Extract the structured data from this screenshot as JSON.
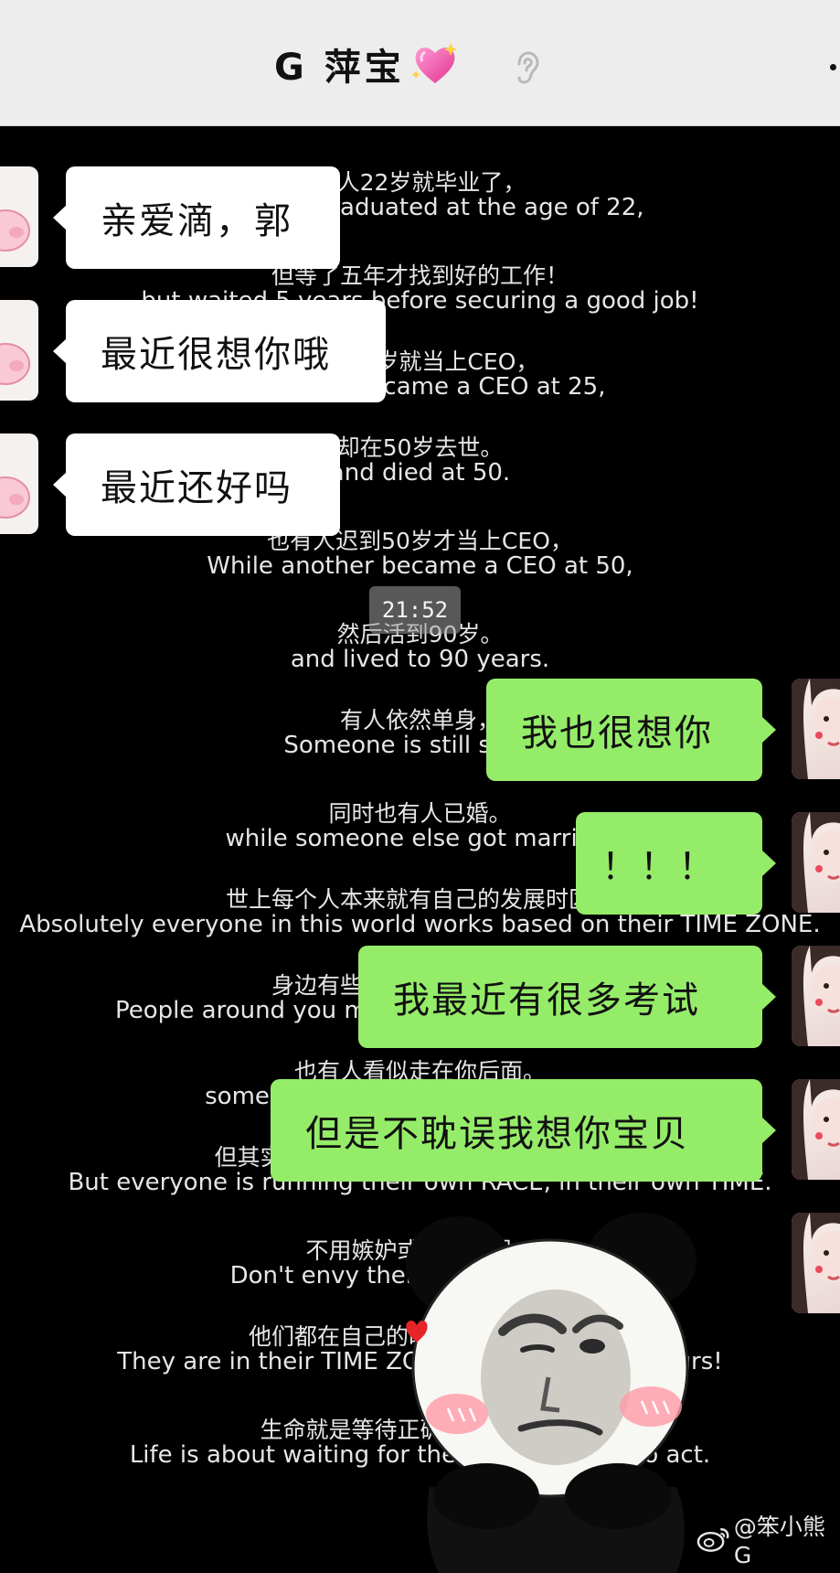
{
  "header": {
    "title": "G 萍宝",
    "heart_emoji": "sparkling-heart",
    "ear_icon": "ear-icon"
  },
  "background_text": [
    {
      "cn": "有人22岁就毕业了，",
      "en": "Someone graduated at the age of 22,"
    },
    {
      "cn": "但等了五年才找到好的工作！",
      "en": "but waited 5 years before securing a good job!"
    },
    {
      "cn": "有人25岁就当上CEO，",
      "en": "Someone became a CEO at 25,"
    },
    {
      "cn": "却在50岁去世。",
      "en": "and died at 50."
    },
    {
      "cn": "也有人迟到50岁才当上CEO，",
      "en": "While another became a CEO at 50,"
    },
    {
      "cn": "然后活到90岁。",
      "en": "and lived to 90 years."
    },
    {
      "cn": "有人依然单身，",
      "en": "Someone is still single,"
    },
    {
      "cn": "同时也有人已婚。",
      "en": "while someone else got married."
    },
    {
      "cn": "世上每个人本来就有自己的发展时区。",
      "en": "Absolutely everyone in this world works based on their TIME ZONE."
    },
    {
      "cn": "身边有些人看似走在你前面，",
      "en": "People around you might seem to go ahead of you,"
    },
    {
      "cn": "也有人看似走在你后面。",
      "en": "some might seem to be behind you."
    },
    {
      "cn": "但其实每个人在自己的时区有自己的步程",
      "en": "But everyone is running their own RACE, in their own TIME."
    },
    {
      "cn": "不用嫉妒或嘲笑他们。",
      "en": "Don't envy them or mock them."
    },
    {
      "cn": "他们都在自己的时区里，你也是！",
      "en": "They are in their TIME ZONE, and you are in yours!"
    },
    {
      "cn": "生命就是等待正确的行动时机。",
      "en": "Life is about waiting for the right moment to act."
    }
  ],
  "messages": [
    {
      "side": "left",
      "text": "亲爱滴，郭"
    },
    {
      "side": "left",
      "text": "最近很想你哦"
    },
    {
      "side": "left",
      "text": "最近还好吗"
    },
    {
      "side": "right",
      "text": "我也很想你"
    },
    {
      "side": "right",
      "text": "！！！"
    },
    {
      "side": "right",
      "text": "我最近有很多考试"
    },
    {
      "side": "right",
      "text": "但是不耽误我想你宝贝"
    }
  ],
  "timestamp": "21:52",
  "sticker": "panda-meme-sticker",
  "watermark": "@笨小熊G",
  "colors": {
    "header_bg": "#ededed",
    "chat_bg": "#000000",
    "bubble_in": "#ffffff",
    "bubble_out": "#95ec69"
  }
}
